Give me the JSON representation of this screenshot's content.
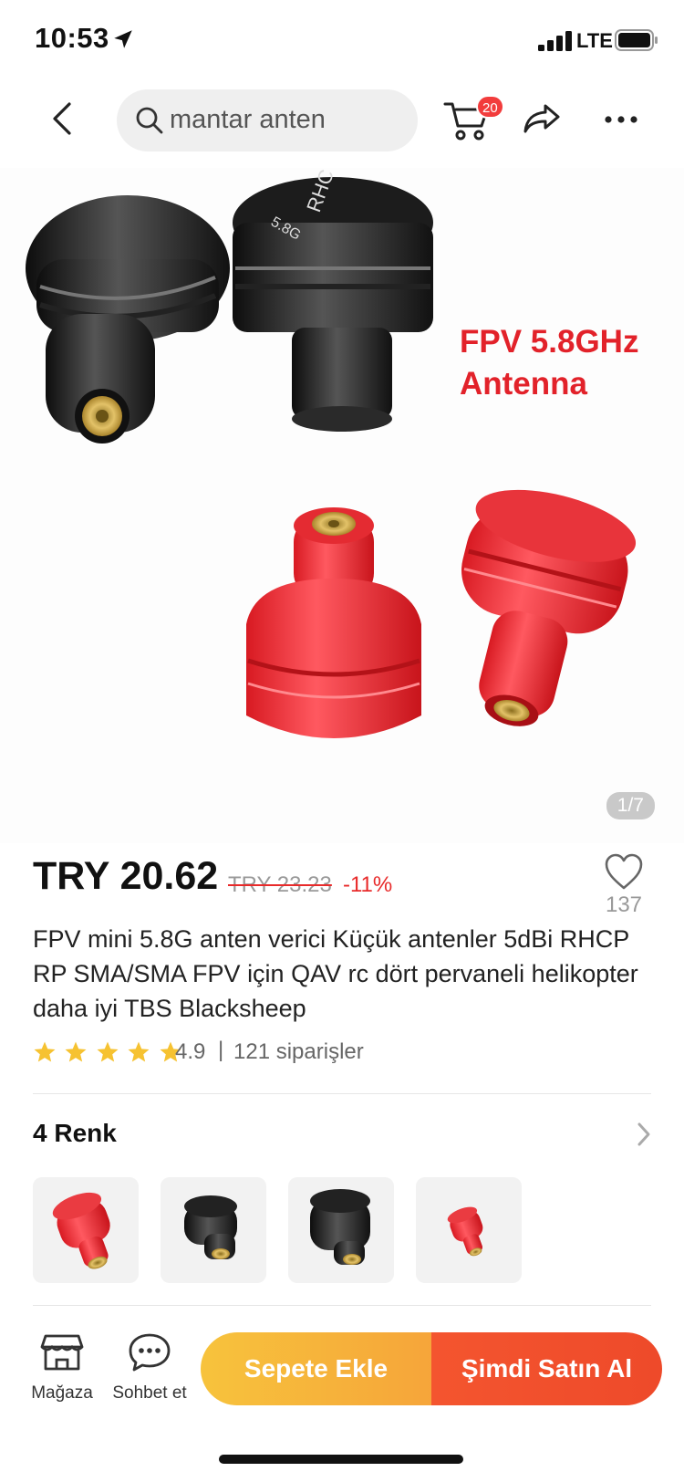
{
  "status_bar": {
    "time": "10:53",
    "network": "LTE",
    "icons": [
      "location-arrow-icon",
      "cellular-signal-icon",
      "battery-icon"
    ]
  },
  "nav": {
    "search_text": "mantar anten",
    "cart_badge": "20",
    "icons": [
      "chevron-left-icon",
      "search-icon",
      "cart-icon",
      "share-icon",
      "more-icon"
    ]
  },
  "gallery": {
    "caption_line1": "FPV 5.8GHz",
    "caption_line2": "Antenna",
    "cap_text_1": "RHC",
    "cap_text_2": "5.8G",
    "counter": "1/7"
  },
  "product": {
    "price": "TRY 20.62",
    "old_price": "TRY 23.23",
    "discount": "-11%",
    "wish_count": "137",
    "title": "FPV mini 5.8G anten verici Küçük antenler 5dBi RHCP RP SMA/SMA FPV için QAV rc dört pervaneli helikopter daha iyi TBS Blacksheep",
    "rating": "4.9",
    "rating_stars": 5,
    "rating_separator": "|",
    "orders": "121 siparişler"
  },
  "variants": {
    "title": "4 Renk",
    "items": [
      {
        "color": "red"
      },
      {
        "color": "black"
      },
      {
        "color": "black"
      },
      {
        "color": "red"
      }
    ]
  },
  "bottom_bar": {
    "store_label": "Mağaza",
    "chat_label": "Sohbet et",
    "add_to_cart": "Sepete Ekle",
    "buy_now": "Şimdi Satın Al"
  },
  "colors": {
    "accent_red": "#e82a2a",
    "add_to_cart_bg": "#f7c33c",
    "buy_now_bg": "#f4552f",
    "badge": "#f23c3c",
    "star": "#f6c231"
  }
}
